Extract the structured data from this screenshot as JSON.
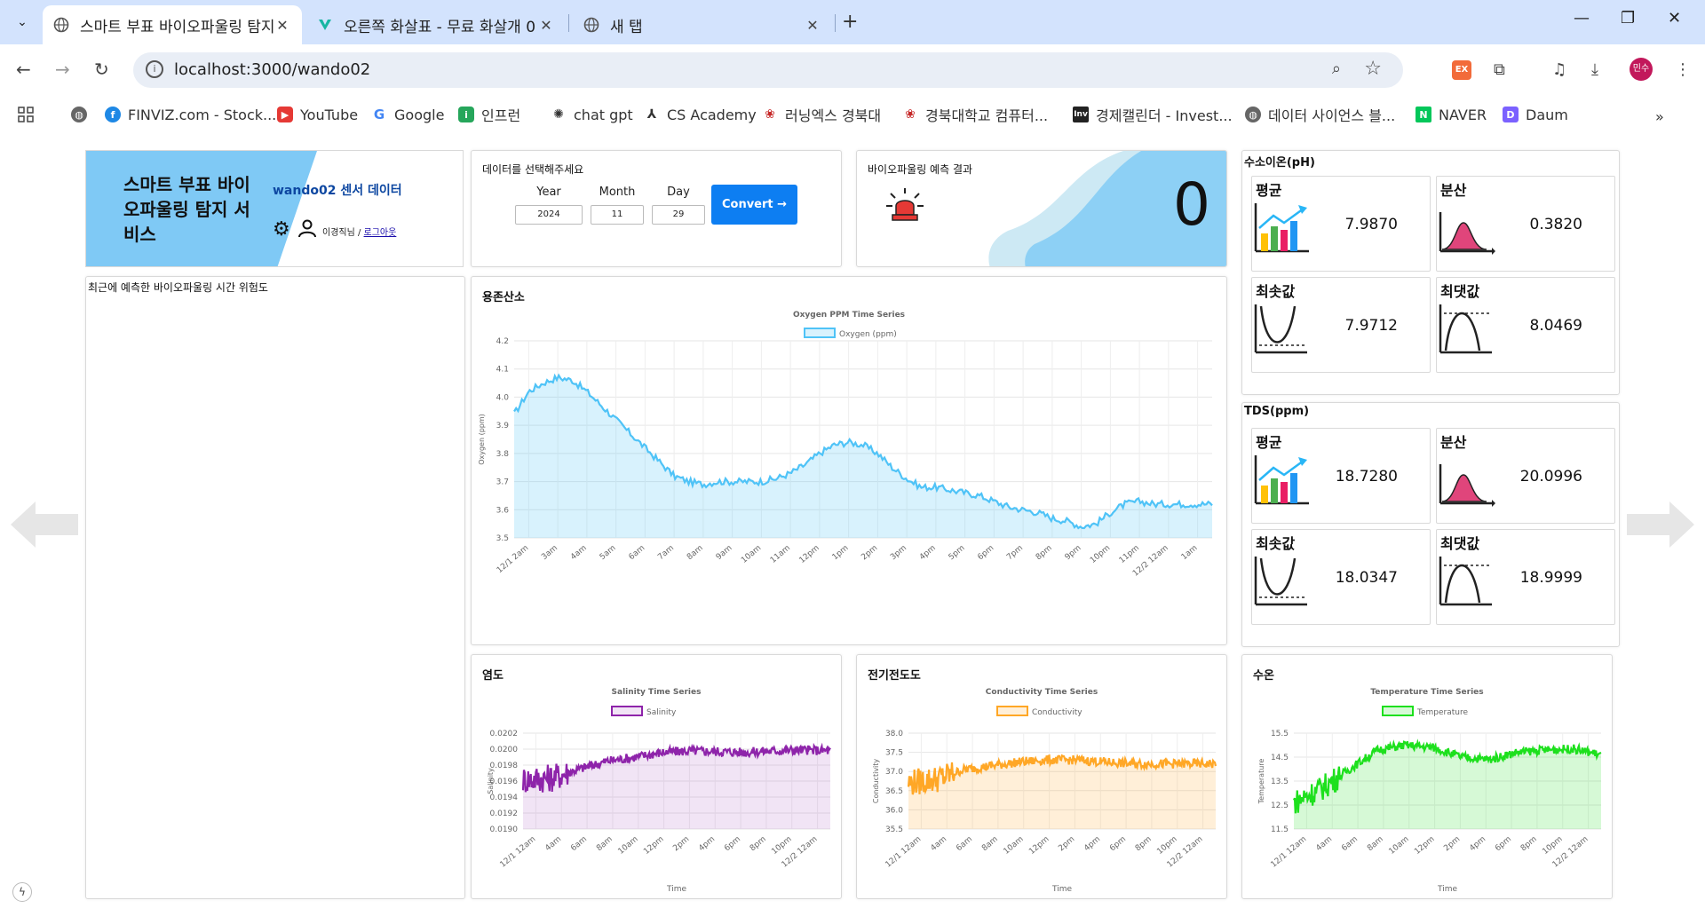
{
  "browser": {
    "tabs": [
      {
        "title": "스마트 부표 바이오파울링 탐지",
        "icon": "globe-icon",
        "active": true
      },
      {
        "title": "오른쪽 화살표 - 무료 화살개 0",
        "icon": "vectorizer-icon",
        "active": false
      },
      {
        "title": "새 탭",
        "icon": "globe-icon",
        "active": false
      }
    ],
    "url": "localhost:3000/wando02",
    "profile_label": "민수",
    "ext_label": "EX",
    "bookmarks": [
      {
        "label": "FINVIZ.com - Stock...",
        "icon": "finviz-icon",
        "color": "#1e88e5"
      },
      {
        "label": "YouTube",
        "icon": "youtube-icon",
        "color": "#e53935"
      },
      {
        "label": "Google",
        "icon": "google-icon",
        "color": "#4285f4"
      },
      {
        "label": "인프런",
        "icon": "inflearn-icon",
        "color": "#26a65b"
      },
      {
        "label": "chat gpt",
        "icon": "openai-icon",
        "color": "#333333"
      },
      {
        "label": "CS Academy",
        "icon": "cs-academy-icon",
        "color": "#333333"
      },
      {
        "label": "러닝엑스 경북대",
        "icon": "knu-icon",
        "color": "#c62828"
      },
      {
        "label": "경북대학교 컴퓨터...",
        "icon": "knu-icon",
        "color": "#c62828"
      },
      {
        "label": "경제캘린더 - Invest...",
        "icon": "investing-icon",
        "color": "#222222"
      },
      {
        "label": "데이터 사이언스 블...",
        "icon": "globe-icon",
        "color": "#555555"
      },
      {
        "label": "NAVER",
        "icon": "naver-icon",
        "color": "#03c75a"
      },
      {
        "label": "Daum",
        "icon": "daum-icon",
        "color": "#7b61ff"
      }
    ]
  },
  "header": {
    "service_title": "스마트 부표 바이오파울링 탐지 서비스",
    "station_label": "wando02 센서 데이터",
    "user_text": "이경직님 / ",
    "logout_label": "로그아웃"
  },
  "selector": {
    "title": "데이터를 선택해주세요",
    "year_label": "Year",
    "month_label": "Month",
    "day_label": "Day",
    "year_value": "2024",
    "month_value": "11",
    "day_value": "29",
    "convert_label": "Convert →"
  },
  "prediction": {
    "title": "바이오파울링 예측 결과",
    "value": "0",
    "alarm_color": "#e53935"
  },
  "ph": {
    "title": "수소이온(pH)",
    "mean_label": "평균",
    "mean": "7.9870",
    "var_label": "분산",
    "var": "0.3820",
    "min_label": "최솟값",
    "min": "7.9712",
    "max_label": "최댓값",
    "max": "8.0469"
  },
  "tds": {
    "title": "TDS(ppm)",
    "mean_label": "평균",
    "mean": "18.7280",
    "var_label": "분산",
    "var": "20.0996",
    "min_label": "최솟값",
    "min": "18.0347",
    "max_label": "최댓값",
    "max": "18.9999"
  },
  "risk": {
    "title": "최근에 예측한 바이오파울링 시간 위험도"
  },
  "charts": {
    "oxygen": {
      "card_title": "용존산소"
    },
    "salinity": {
      "card_title": "염도"
    },
    "conductivity": {
      "card_title": "전기전도도"
    },
    "temperature": {
      "card_title": "수온"
    }
  },
  "chart_data": [
    {
      "id": "oxygen",
      "type": "area",
      "title": "Oxygen PPM Time Series",
      "ylabel": "Oxygen (ppm)",
      "xlabel": "",
      "color": "#4fc3f7",
      "fill": "rgba(79,195,247,0.22)",
      "ylim": [
        3.5,
        4.2
      ],
      "yticks": [
        3.5,
        3.6,
        3.7,
        3.8,
        3.9,
        4.0,
        4.1,
        4.2
      ],
      "ytick_labels": [
        "3.5",
        "3.6",
        "3.7",
        "3.8",
        "3.9",
        "4.0",
        "4.1",
        "4.2"
      ],
      "xticks": [
        "12/1 2am",
        "3am",
        "4am",
        "5am",
        "6am",
        "7am",
        "8am",
        "9am",
        "10am",
        "11am",
        "12pm",
        "1pm",
        "2pm",
        "3pm",
        "4pm",
        "5pm",
        "6pm",
        "7pm",
        "8pm",
        "9pm",
        "10pm",
        "11pm",
        "12/2 12am",
        "1am"
      ],
      "series": [
        {
          "name": "Oxygen (ppm)",
          "x": [
            0,
            0.5,
            1,
            1.5,
            2,
            2.5,
            3,
            3.5,
            4,
            4.5,
            5,
            5.5,
            6,
            6.5,
            7,
            7.5,
            8,
            8.5,
            9,
            9.5,
            10,
            10.5,
            11,
            11.5,
            12,
            12.5,
            13,
            13.5,
            14,
            14.5,
            15,
            15.5,
            16,
            16.5,
            17,
            17.5,
            18,
            18.5,
            19,
            19.5,
            20,
            20.5,
            21,
            21.5,
            22,
            22.5,
            23,
            23.5,
            24
          ],
          "values": [
            3.94,
            4.02,
            4.05,
            4.07,
            4.06,
            4.02,
            3.97,
            3.92,
            3.87,
            3.82,
            3.77,
            3.72,
            3.7,
            3.69,
            3.7,
            3.7,
            3.7,
            3.7,
            3.71,
            3.73,
            3.76,
            3.8,
            3.83,
            3.84,
            3.83,
            3.8,
            3.75,
            3.71,
            3.68,
            3.68,
            3.67,
            3.66,
            3.65,
            3.63,
            3.61,
            3.6,
            3.59,
            3.57,
            3.56,
            3.54,
            3.55,
            3.59,
            3.62,
            3.63,
            3.62,
            3.62,
            3.62,
            3.62,
            3.62
          ],
          "noise": 0.012
        }
      ]
    },
    {
      "id": "salinity",
      "type": "area",
      "title": "Salinity Time Series",
      "ylabel": "Salinity",
      "xlabel": "Time",
      "color": "#8e24aa",
      "fill": "rgba(142,36,170,0.12)",
      "ylim": [
        0.019,
        0.0202
      ],
      "yticks": [
        0.019,
        0.0192,
        0.0194,
        0.0196,
        0.0198,
        0.02,
        0.0202
      ],
      "ytick_labels": [
        "0.0190",
        "0.0192",
        "0.0194",
        "0.0196",
        "0.0198",
        "0.0200",
        "0.0202"
      ],
      "xticks": [
        "12/1 12am",
        "4am",
        "6am",
        "8am",
        "10am",
        "12pm",
        "2pm",
        "4pm",
        "6pm",
        "8pm",
        "10pm",
        "12/2 12am"
      ],
      "series": [
        {
          "name": "Salinity",
          "x": [
            0,
            1,
            2,
            3,
            4,
            5,
            6,
            7,
            8,
            9,
            10,
            11
          ],
          "values": [
            0.01962,
            0.01964,
            0.01975,
            0.01985,
            0.0199,
            0.01996,
            0.01998,
            0.01997,
            0.01996,
            0.01998,
            0.01999,
            0.01998
          ],
          "noise": 6e-05
        }
      ]
    },
    {
      "id": "conductivity",
      "type": "area",
      "title": "Conductivity Time Series",
      "ylabel": "Conductivity",
      "xlabel": "Time",
      "color": "#ffa726",
      "fill": "rgba(255,167,38,0.18)",
      "ylim": [
        35.5,
        38.0
      ],
      "yticks": [
        35.5,
        36.0,
        36.5,
        37.0,
        37.5,
        38.0
      ],
      "ytick_labels": [
        "35.5",
        "36.0",
        "36.5",
        "37.0",
        "37.5",
        "38.0"
      ],
      "xticks": [
        "12/1 12am",
        "4am",
        "6am",
        "8am",
        "10am",
        "12pm",
        "2pm",
        "4pm",
        "6pm",
        "8pm",
        "10pm",
        "12/2 12am"
      ],
      "series": [
        {
          "name": "Conductivity",
          "x": [
            0,
            1,
            2,
            3,
            4,
            5,
            6,
            7,
            8,
            9,
            10,
            11
          ],
          "values": [
            36.7,
            36.8,
            37.05,
            37.15,
            37.25,
            37.3,
            37.3,
            37.25,
            37.2,
            37.2,
            37.2,
            37.2
          ],
          "noise": 0.12
        }
      ]
    },
    {
      "id": "temperature",
      "type": "area",
      "title": "Temperature Time Series",
      "ylabel": "Temperature",
      "xlabel": "Time",
      "color": "#1de01d",
      "fill": "rgba(29,224,29,0.18)",
      "ylim": [
        11.5,
        15.5
      ],
      "yticks": [
        11.5,
        12.5,
        13.5,
        14.5,
        15.5
      ],
      "ytick_labels": [
        "11.5",
        "12.5",
        "13.5",
        "14.5",
        "15.5"
      ],
      "xticks": [
        "12/1 12am",
        "4am",
        "6am",
        "8am",
        "10am",
        "12pm",
        "2pm",
        "4pm",
        "6pm",
        "8pm",
        "10pm",
        "12/2 12am"
      ],
      "series": [
        {
          "name": "Temperature",
          "x": [
            0,
            1,
            2,
            3,
            4,
            5,
            6,
            7,
            8,
            9,
            10,
            11
          ],
          "values": [
            12.6,
            13.2,
            14.0,
            14.8,
            15.0,
            14.9,
            14.5,
            14.4,
            14.7,
            14.8,
            14.85,
            14.6
          ],
          "noise": 0.18
        }
      ]
    }
  ]
}
